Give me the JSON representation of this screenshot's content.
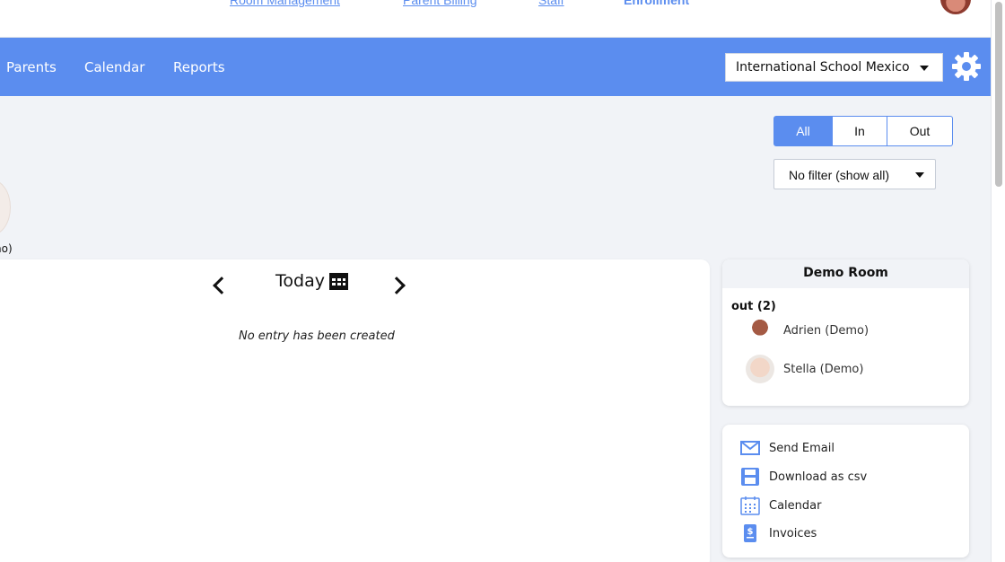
{
  "top_links": [
    {
      "label": "Room Management",
      "style": "underline"
    },
    {
      "label": "Parent Billing",
      "style": "underline"
    },
    {
      "label": "Staff",
      "style": "underline"
    },
    {
      "label": "Enrollment",
      "style": "bold"
    }
  ],
  "nav": {
    "items": [
      {
        "label": "Parents"
      },
      {
        "label": "Calendar"
      },
      {
        "label": "Reports"
      }
    ],
    "school_select": "International School Mexico"
  },
  "filters": {
    "segments": [
      "All",
      "In",
      "Out"
    ],
    "active_segment": "All",
    "filter_select": "No filter (show all)"
  },
  "left_child": {
    "label": "no)"
  },
  "main": {
    "date_label": "Today",
    "empty_note": "No entry has been created"
  },
  "room": {
    "title": "Demo Room",
    "status_label": "out (2)",
    "children": [
      {
        "name": "Adrien (Demo)"
      },
      {
        "name": "Stella (Demo)"
      }
    ]
  },
  "actions": [
    {
      "label": "Send Email",
      "icon": "mail-icon"
    },
    {
      "label": "Download as csv",
      "icon": "save-icon"
    },
    {
      "label": "Calendar",
      "icon": "calendar-icon"
    },
    {
      "label": "Invoices",
      "icon": "invoice-icon"
    }
  ],
  "colors": {
    "primary": "#5b8def",
    "background": "#f1f3f7"
  }
}
